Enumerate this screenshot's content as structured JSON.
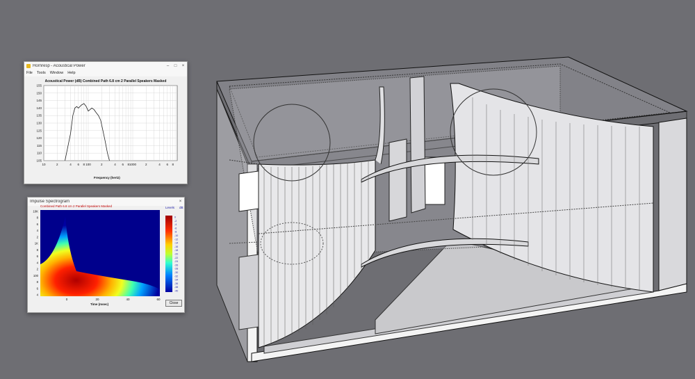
{
  "colors": {
    "desktop": "#6e6e73",
    "accent_red": "#c00000"
  },
  "power_window": {
    "title": "Hornresp - Acoustical Power",
    "menu": [
      "File",
      "Tools",
      "Window",
      "Help"
    ],
    "heading": "Acoustical Power (dB)   Combined   Path 6.8 cm   2 Parallel Speakers   Masked",
    "xlabel": "Frequency (hertz)",
    "y_ticks": [
      "155",
      "150",
      "145",
      "140",
      "135",
      "130",
      "125",
      "120",
      "115",
      "110",
      "105"
    ],
    "x_ticks": [
      "10",
      "2",
      "4",
      "6",
      "8",
      "100",
      "2",
      "4",
      "6",
      "8",
      "1000",
      "2",
      "4",
      "6",
      "8"
    ],
    "chart_data": {
      "type": "line",
      "title": "Acoustical Power (dB)",
      "xlabel": "Frequency (hertz)",
      "ylabel": "",
      "xscale": "log",
      "ylim": [
        105,
        155
      ],
      "xlim": [
        10,
        10000
      ],
      "grid": true,
      "x": [
        30,
        40,
        45,
        50,
        55,
        60,
        70,
        80,
        90,
        100,
        110,
        120,
        135,
        150,
        170,
        190,
        210,
        240,
        270,
        300
      ],
      "y": [
        105,
        123,
        135,
        140,
        141,
        140,
        142,
        143,
        141,
        138,
        139,
        140,
        139,
        137,
        135,
        132,
        126,
        118,
        110,
        105
      ]
    }
  },
  "spectro_window": {
    "title": "Impulse Spectrogram",
    "header_left": "Combined   Path 6.8 cm   2 Parallel Speakers   Masked",
    "legend_unit": "dB",
    "legend_title": "Levels",
    "y_ticks": [
      "10K",
      "8",
      "6",
      "4",
      "2",
      "1K",
      "8",
      "6",
      "4",
      "2",
      "100",
      "8",
      "6",
      "4"
    ],
    "x_ticks": [
      "0",
      "20",
      "40",
      "60"
    ],
    "xlabel": "Time (msec)",
    "close_label": "Close",
    "scale_values": [
      "0",
      "-2",
      "-4",
      "-6",
      "-8",
      "-10",
      "-12",
      "-14",
      "-16",
      "-18",
      "-20",
      "-22",
      "-24",
      "-26",
      "-28",
      "-30",
      "-32",
      "-34",
      "-36",
      "-38",
      "-40"
    ]
  }
}
